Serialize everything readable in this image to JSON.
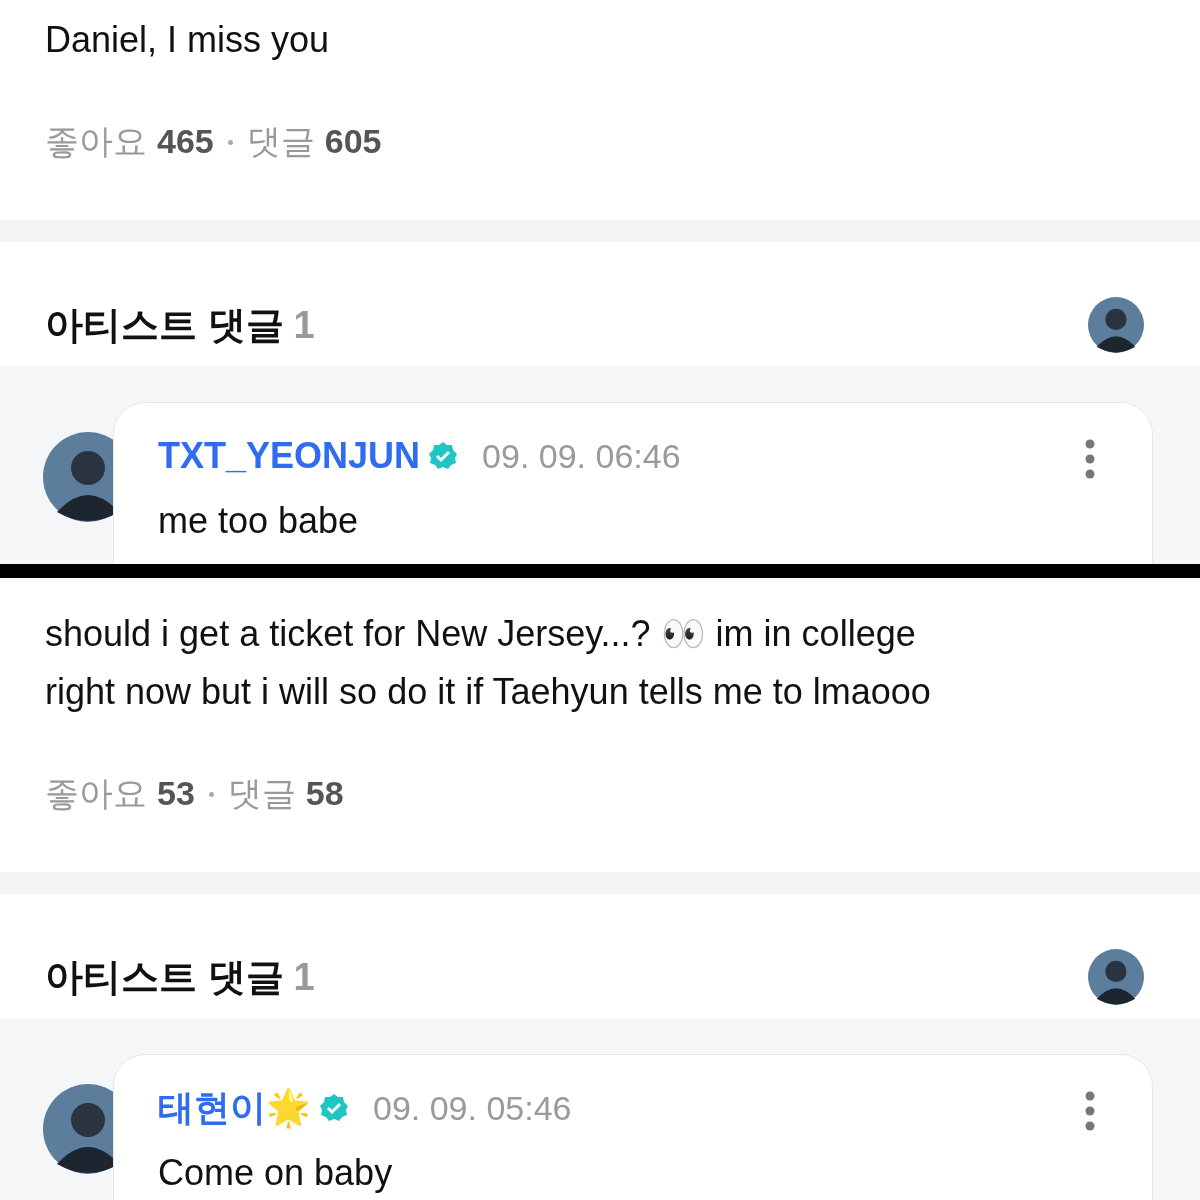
{
  "panels": [
    {
      "post": {
        "lines": [
          "Daniel, I miss you"
        ],
        "likes_label": "좋아요",
        "likes": "465",
        "comments_label": "댓글",
        "comments": "605"
      },
      "artist_comments": {
        "title": "아티스트 댓글",
        "count": "1",
        "comment": {
          "author": "TXT_YEONJUN",
          "verified": true,
          "time": "09. 09. 06:46",
          "text": "me too babe"
        }
      }
    },
    {
      "post": {
        "lines": [
          "should i get a ticket for New Jersey...? 👀 im in college",
          "right now but i will so do it if Taehyun tells me to lmaooo"
        ],
        "likes_label": "좋아요",
        "likes": "53",
        "comments_label": "댓글",
        "comments": "58"
      },
      "artist_comments": {
        "title": "아티스트 댓글",
        "count": "1",
        "comment": {
          "author": "태현이🌟",
          "verified": true,
          "time": "09. 09. 05:46",
          "text": "Come on baby"
        }
      }
    }
  ]
}
